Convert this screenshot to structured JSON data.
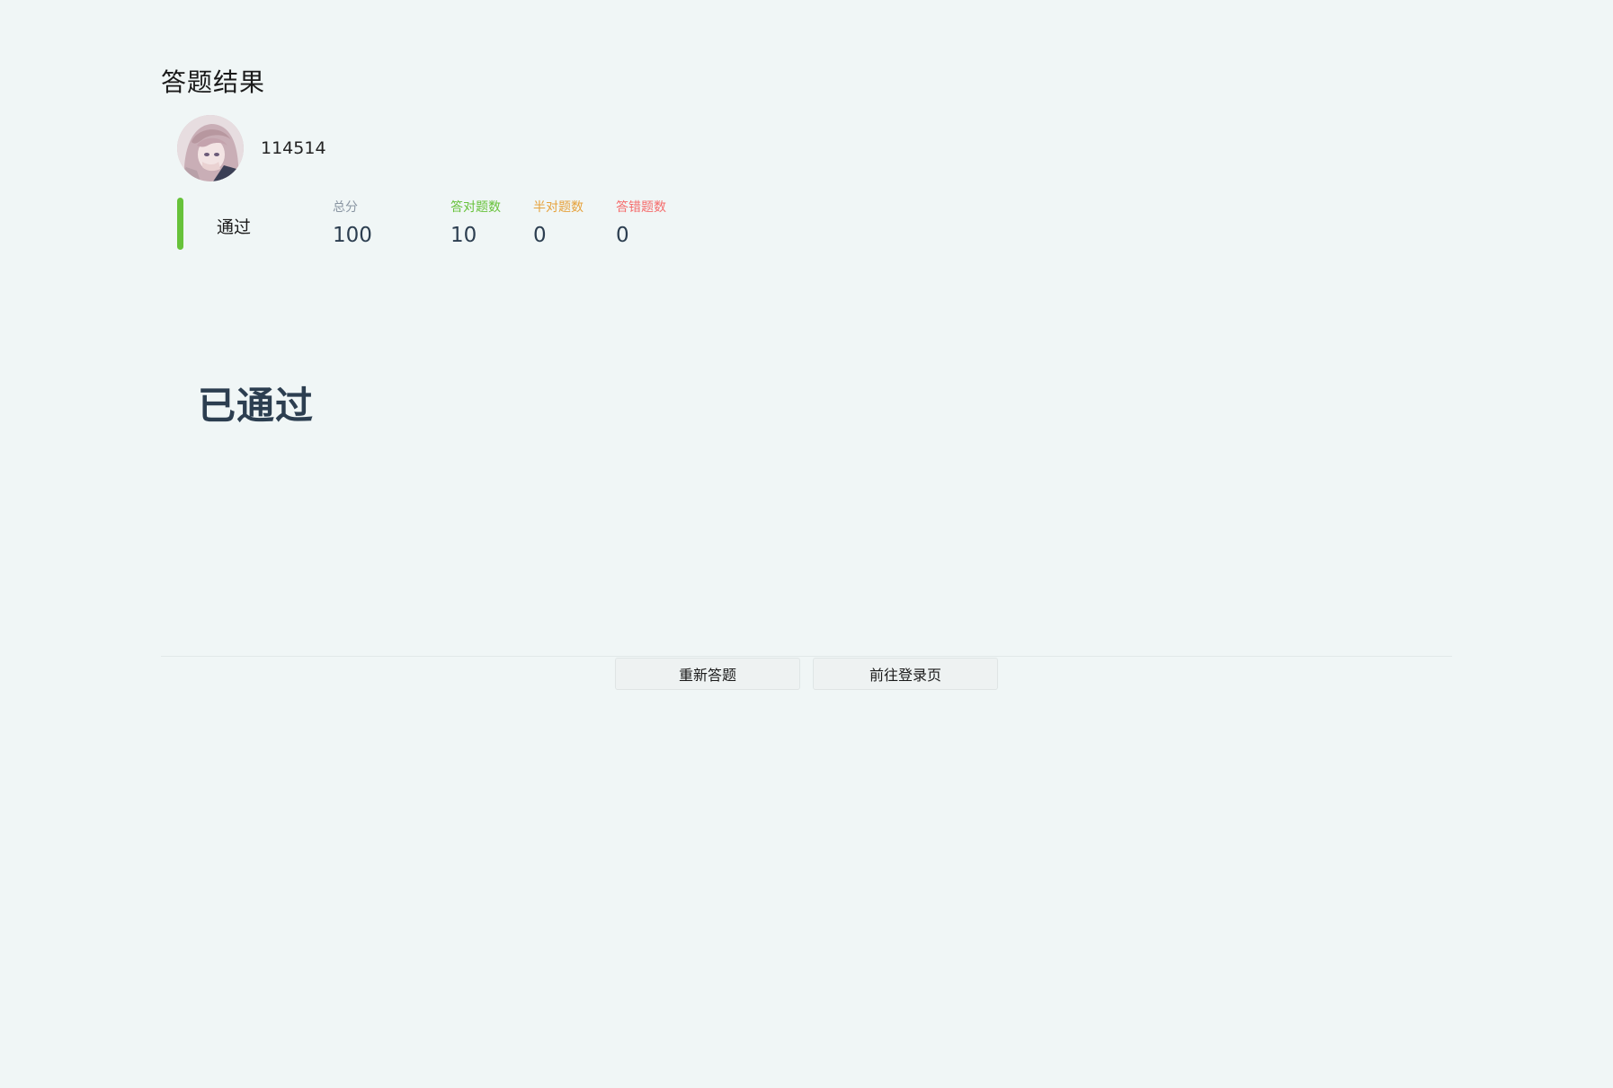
{
  "page": {
    "title": "答题结果"
  },
  "user": {
    "name": "114514"
  },
  "result": {
    "status": "通过",
    "status_color": "#67c23a",
    "big_status": "已通过"
  },
  "stats": [
    {
      "label": "总分",
      "value": "100",
      "color": "#8a96a3"
    },
    {
      "label": "答对题数",
      "value": "10",
      "color": "#67c23a"
    },
    {
      "label": "半对题数",
      "value": "0",
      "color": "#e6a23c"
    },
    {
      "label": "答错题数",
      "value": "0",
      "color": "#f56c6c"
    }
  ],
  "actions": {
    "retry_label": "重新答题",
    "login_label": "前往登录页"
  }
}
